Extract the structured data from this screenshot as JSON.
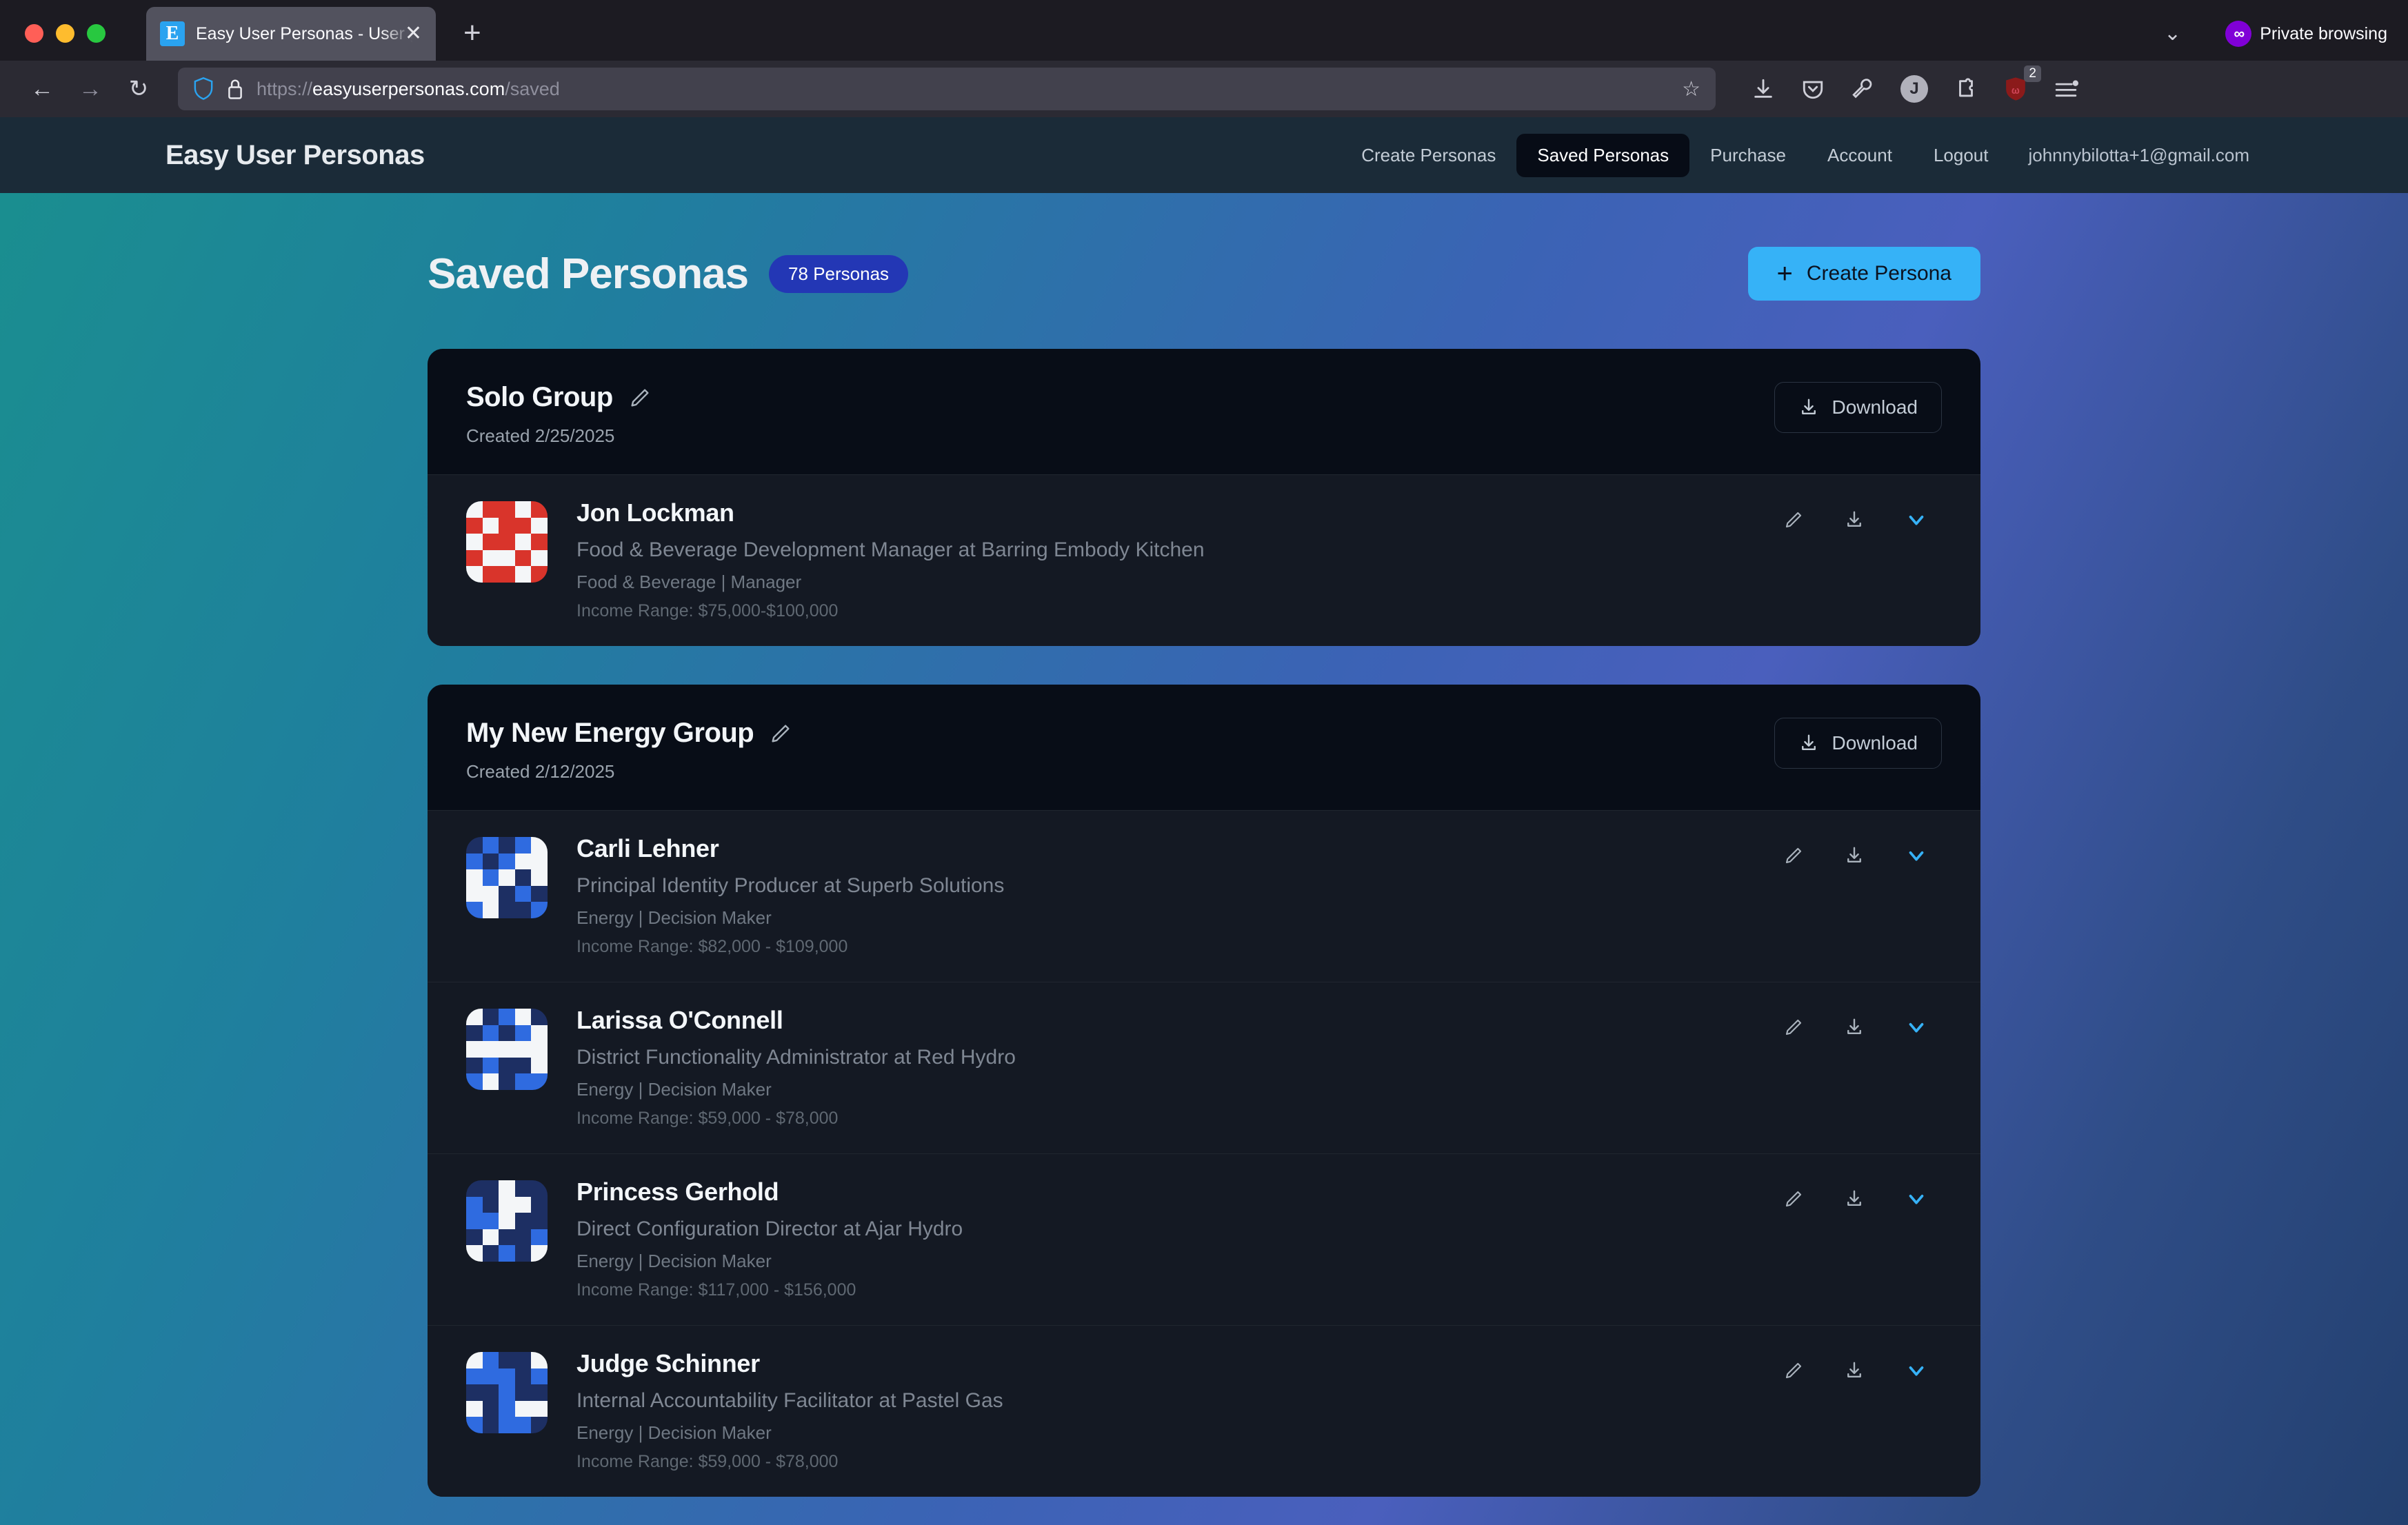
{
  "browser": {
    "tab": {
      "title": "Easy User Personas - User gene",
      "favicon_letter": "E",
      "close_icon": "✕"
    },
    "newtab_label": "+",
    "chevron_label": "⌄",
    "private_browsing_label": "Private browsing",
    "private_browsing_icon": "∞",
    "url_scheme": "https://",
    "url_host": "easyuserpersonas.com",
    "url_path": "/saved",
    "shield_badge_count": "2",
    "profile_initial": "J",
    "back_icon": "←",
    "forward_icon": "→",
    "reload_icon": "↻",
    "star_icon": "☆"
  },
  "appnav": {
    "brand": "Easy User Personas",
    "links": [
      {
        "label": "Create Personas",
        "active": false
      },
      {
        "label": "Saved Personas",
        "active": true
      },
      {
        "label": "Purchase",
        "active": false
      },
      {
        "label": "Account",
        "active": false
      },
      {
        "label": "Logout",
        "active": false
      }
    ],
    "email": "johnnybilotta+1@gmail.com"
  },
  "page": {
    "title": "Saved Personas",
    "count_badge": "78 Personas",
    "create_button": "Create Persona",
    "create_button_icon": "+",
    "accent_color": "#36b2f7",
    "badge_color": "#2337b5"
  },
  "groups": [
    {
      "name": "Solo Group",
      "created": "Created 2/25/2025",
      "edit_icon": "pencil-icon",
      "download_label": "Download",
      "personas": [
        {
          "name": "Jon Lockman",
          "role": "Food & Beverage Development Manager at Barring Embody Kitchen",
          "meta": "Food & Beverage | Manager",
          "income": "Income Range: $75,000-$100,000",
          "avatar_color": "#d9342b",
          "avatar_color_dark": "#8f1f18",
          "avatar_bits": "0110110110011011001001101100101101100100"
        }
      ]
    },
    {
      "name": "My New Energy Group",
      "created": "Created 2/12/2025",
      "edit_icon": "pencil-icon",
      "download_label": "Download",
      "personas": [
        {
          "name": "Carli Lehner",
          "role": "Principal Identity Producer at Superb Solutions",
          "meta": "Energy | Decision Maker",
          "income": "Income Range: $82,000 - $109,000",
          "avatar_color": "#2f6be0",
          "avatar_color_dark": "#1d2f63",
          "avatar_bits": "2121012100010200021210221021002102012021"
        },
        {
          "name": "Larissa O'Connell",
          "role": "District Functionality Administrator at Red Hydro",
          "meta": "Energy | Decision Maker",
          "income": "Income Range: $59,000 - $78,000",
          "avatar_color": "#2f6be0",
          "avatar_color_dark": "#1d2f63",
          "avatar_bits": "0210221210000002122010211021202120102102"
        },
        {
          "name": "Princess Gerhold",
          "role": "Direct Configuration Director at Ajar Hydro",
          "meta": "Energy | Decision Maker",
          "income": "Income Range: $117,000 - $156,000",
          "avatar_color": "#2f6be0",
          "avatar_color_dark": "#1d2f63",
          "avatar_bits": "2202212002110222022102120210212210221012"
        },
        {
          "name": "Judge Schinner",
          "role": "Internal Accountability Facilitator at Pastel Gas",
          "meta": "Energy | Decision Maker",
          "income": "Income Range: $59,000 - $78,000",
          "avatar_color": "#2f6be0",
          "avatar_color_dark": "#1d2f63",
          "avatar_bits": "0122011121221220210012112012112101121011"
        }
      ],
      "row_actions": {
        "edit": "pencil-icon",
        "download": "download-icon",
        "expand": "chevron-down-icon"
      }
    }
  ]
}
